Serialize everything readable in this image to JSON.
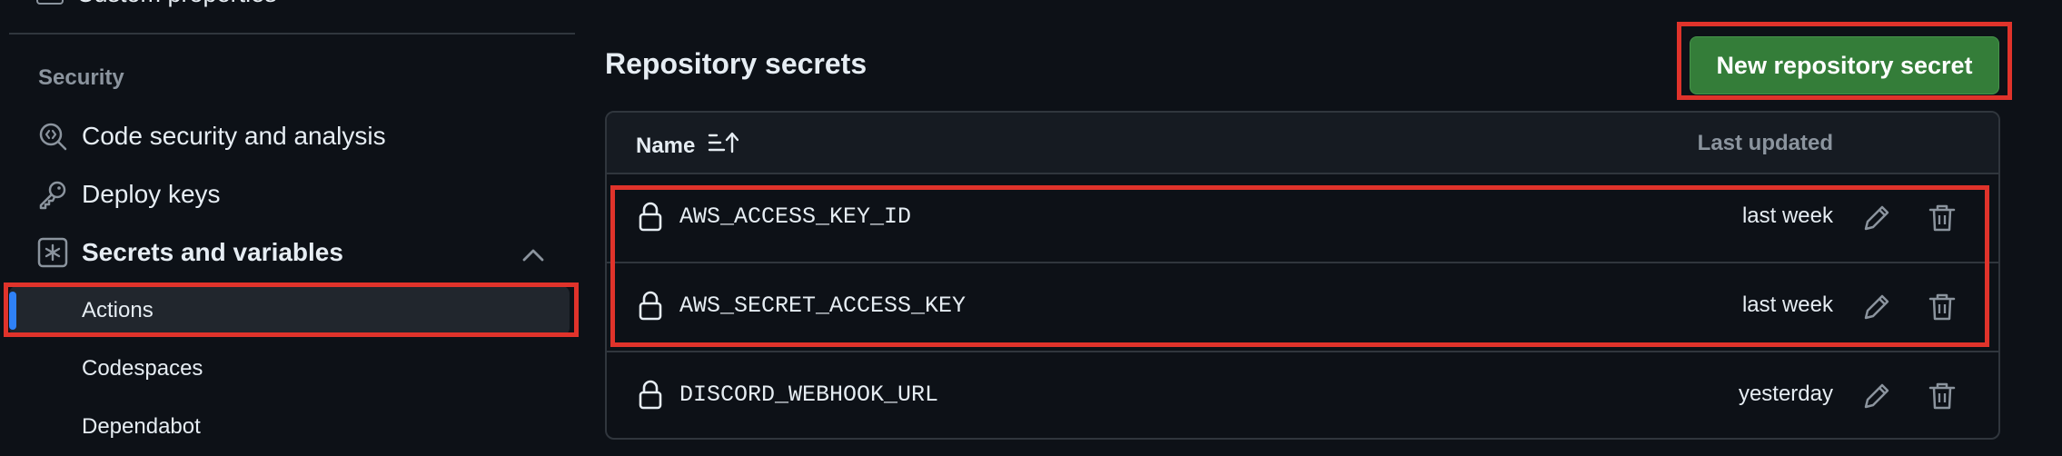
{
  "sidebar": {
    "top_item_label": "Custom properties",
    "section_heading": "Security",
    "items": [
      {
        "label": "Code security and analysis",
        "icon": "codescan-icon"
      },
      {
        "label": "Deploy keys",
        "icon": "key-icon"
      },
      {
        "label": "Secrets and variables",
        "icon": "asterisk-icon",
        "expanded": true
      }
    ],
    "subitems": [
      {
        "label": "Actions",
        "selected": true
      },
      {
        "label": "Codespaces",
        "selected": false
      },
      {
        "label": "Dependabot",
        "selected": false
      }
    ]
  },
  "main": {
    "section_title": "Repository secrets",
    "new_button_label": "New repository secret",
    "table": {
      "columns": {
        "name": "Name",
        "updated": "Last updated"
      },
      "rows": [
        {
          "name": "AWS_ACCESS_KEY_ID",
          "updated": "last week"
        },
        {
          "name": "AWS_SECRET_ACCESS_KEY",
          "updated": "last week"
        },
        {
          "name": "DISCORD_WEBHOOK_URL",
          "updated": "yesterday"
        }
      ]
    }
  },
  "colors": {
    "background": "#0d1117",
    "primary_button": "#347d39",
    "active_indicator": "#2f81f7",
    "highlight": "#e0332b"
  }
}
